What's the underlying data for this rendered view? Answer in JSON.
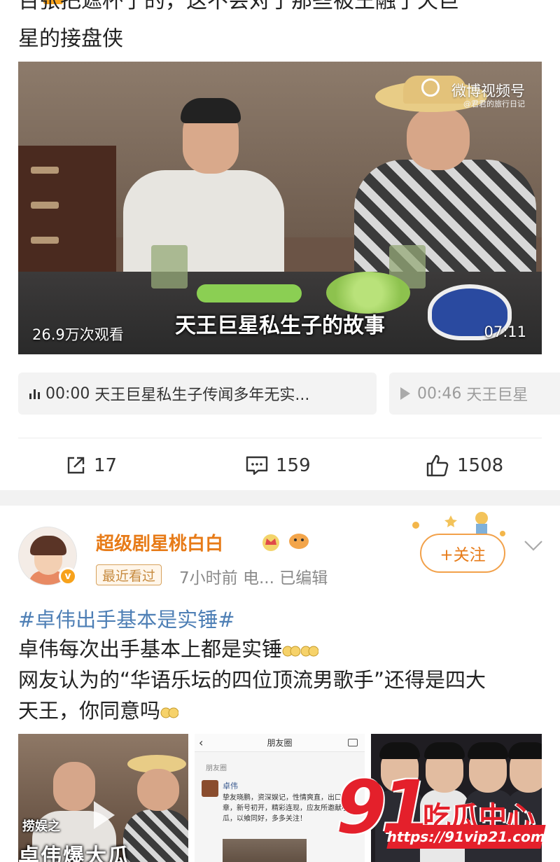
{
  "top_post": {
    "title_cut_line": "百张把遮杯了的，这不会对于那些被王融了天巨",
    "title_line": "星的接盘侠",
    "video": {
      "watermark": "微博视频号",
      "watermark_sub": "@君君的旅行日记",
      "caption": "天王巨星私生子的故事",
      "views": "26.9万次观看",
      "duration": "07:11"
    },
    "chapters": [
      {
        "time": "00:00",
        "text": "天王巨星私生子传闻多年无实..."
      },
      {
        "time": "00:46",
        "text": "天王巨星"
      }
    ],
    "actions": {
      "share_count": "17",
      "comment_count": "159",
      "like_count": "1508"
    }
  },
  "post": {
    "username": "超级剧星桃白白",
    "badge_icons": [
      "crown-icon",
      "pufferfish-icon"
    ],
    "tag": "最近看过",
    "meta": "7小时前  电...  已编辑",
    "follow_label": "+关注",
    "topic": "#卓伟出手基本是实锤#",
    "lines": [
      "卓伟每次出手基本上都是实锤",
      "网友认为的“华语乐坛的四位顶流男歌手”还得是四大",
      "天王，你同意吗"
    ],
    "thumbnails": {
      "t1_caption_small": "捞娱之",
      "t1_caption_big": "卓伟爆大瓜",
      "t2_header": "朋友圈",
      "t2_sub": "朋友圈",
      "t2_name": "卓伟",
      "t2_text": "挚友晓鹏，资深娱记，性情爽直，出口成章，新号初开，精彩连现，应友所邀献小瓜，以飨同好，多多关注！"
    }
  },
  "watermark_logo": {
    "number": "91",
    "text": "吃瓜中心",
    "url": "https://91vip21.com"
  },
  "colors": {
    "accent_orange": "#e77b18",
    "topic_blue": "#4e7fb5",
    "logo_red": "#e4202b"
  }
}
